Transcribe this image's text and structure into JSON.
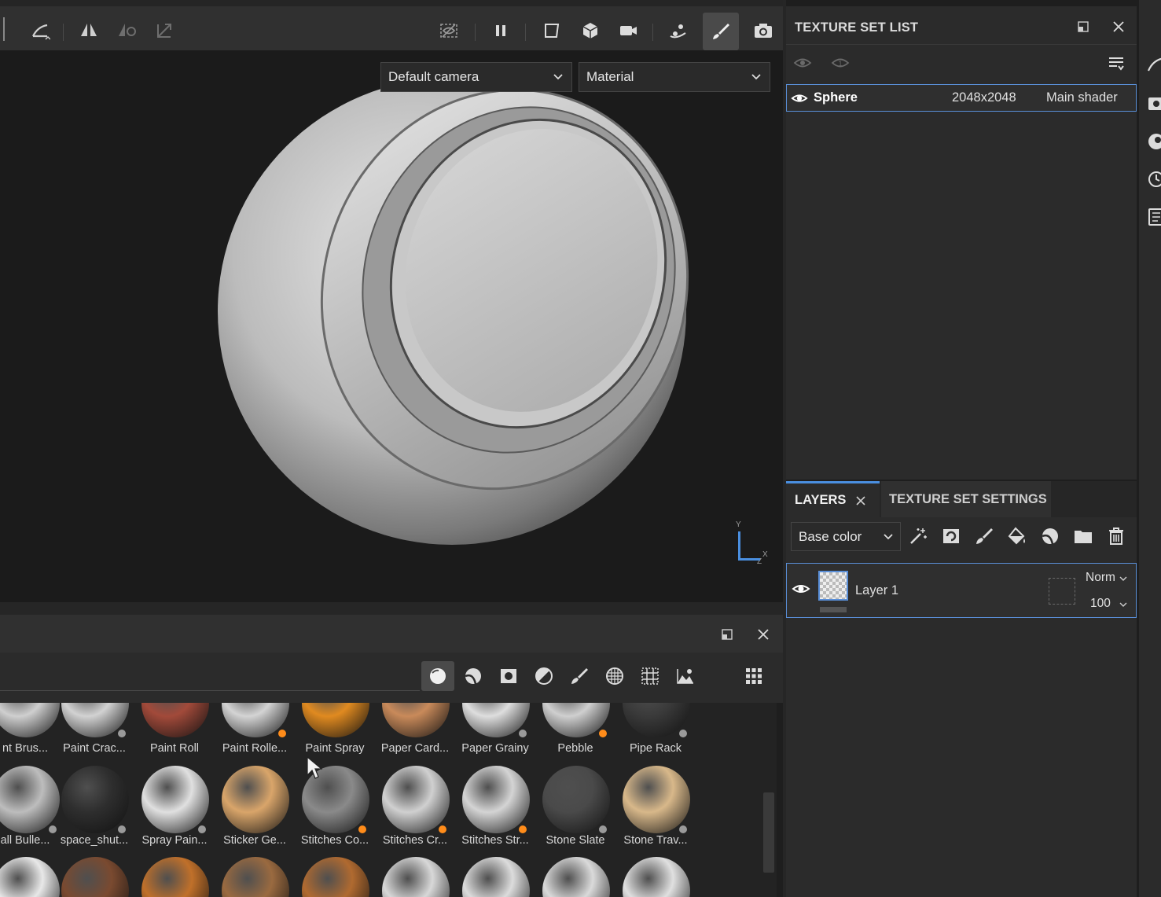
{
  "viewport": {
    "camera_dropdown": "Default camera",
    "channel_dropdown": "Material",
    "axis_labels": {
      "y": "Y",
      "x": "X",
      "z": "Z"
    }
  },
  "texture_set_list": {
    "title": "TEXTURE SET LIST",
    "row": {
      "name": "Sphere",
      "resolution": "2048x2048",
      "shader": "Main shader"
    }
  },
  "layers_panel": {
    "tabs": [
      {
        "label": "LAYERS"
      },
      {
        "label": "TEXTURE SET SETTINGS"
      }
    ],
    "channel_dropdown": "Base color",
    "layer": {
      "name": "Layer 1",
      "blend_mode": "Norm",
      "opacity": "100"
    }
  },
  "shelf": {
    "row1": [
      {
        "label": "nt Brus...",
        "color": "#cfcfcf"
      },
      {
        "label": "Paint Crac...",
        "color": "#d2d2d2"
      },
      {
        "label": "Paint Roll",
        "color": "#a24a3a"
      },
      {
        "label": "Paint Rolle...",
        "color": "#d4d4d4"
      },
      {
        "label": "Paint Spray",
        "color": "#e08a20"
      },
      {
        "label": "Paper Card...",
        "color": "#c98a5a"
      },
      {
        "label": "Paper Grainy",
        "color": "#dedede"
      },
      {
        "label": "Pebble",
        "color": "#cfcfcf"
      },
      {
        "label": "Pipe Rack",
        "color": "#3a3a3a"
      }
    ],
    "row2": [
      {
        "label": "all Bulle...",
        "color": "#bdbdbd"
      },
      {
        "label": "space_shut...",
        "color": "#2e2e2e"
      },
      {
        "label": "Spray Pain...",
        "color": "#e0e0e0"
      },
      {
        "label": "Sticker Ge...",
        "color": "#d9a56a"
      },
      {
        "label": "Stitches Co...",
        "color": "#8a8a8a"
      },
      {
        "label": "Stitches Cr...",
        "color": "#d0d0d0"
      },
      {
        "label": "Stitches Str...",
        "color": "#d4d4d4"
      },
      {
        "label": "Stone Slate",
        "color": "#4a4a4a"
      },
      {
        "label": "Stone Trav...",
        "color": "#d8b88a"
      }
    ],
    "row3": [
      {
        "color": "#e8e8e8"
      },
      {
        "color": "#7a4a30"
      },
      {
        "color": "#c0702a"
      },
      {
        "color": "#9a6a40"
      },
      {
        "color": "#b06a30"
      },
      {
        "color": "#d8d8d8"
      },
      {
        "color": "#dcdcdc"
      },
      {
        "color": "#dadada"
      },
      {
        "color": "#e0e0e0"
      }
    ]
  }
}
